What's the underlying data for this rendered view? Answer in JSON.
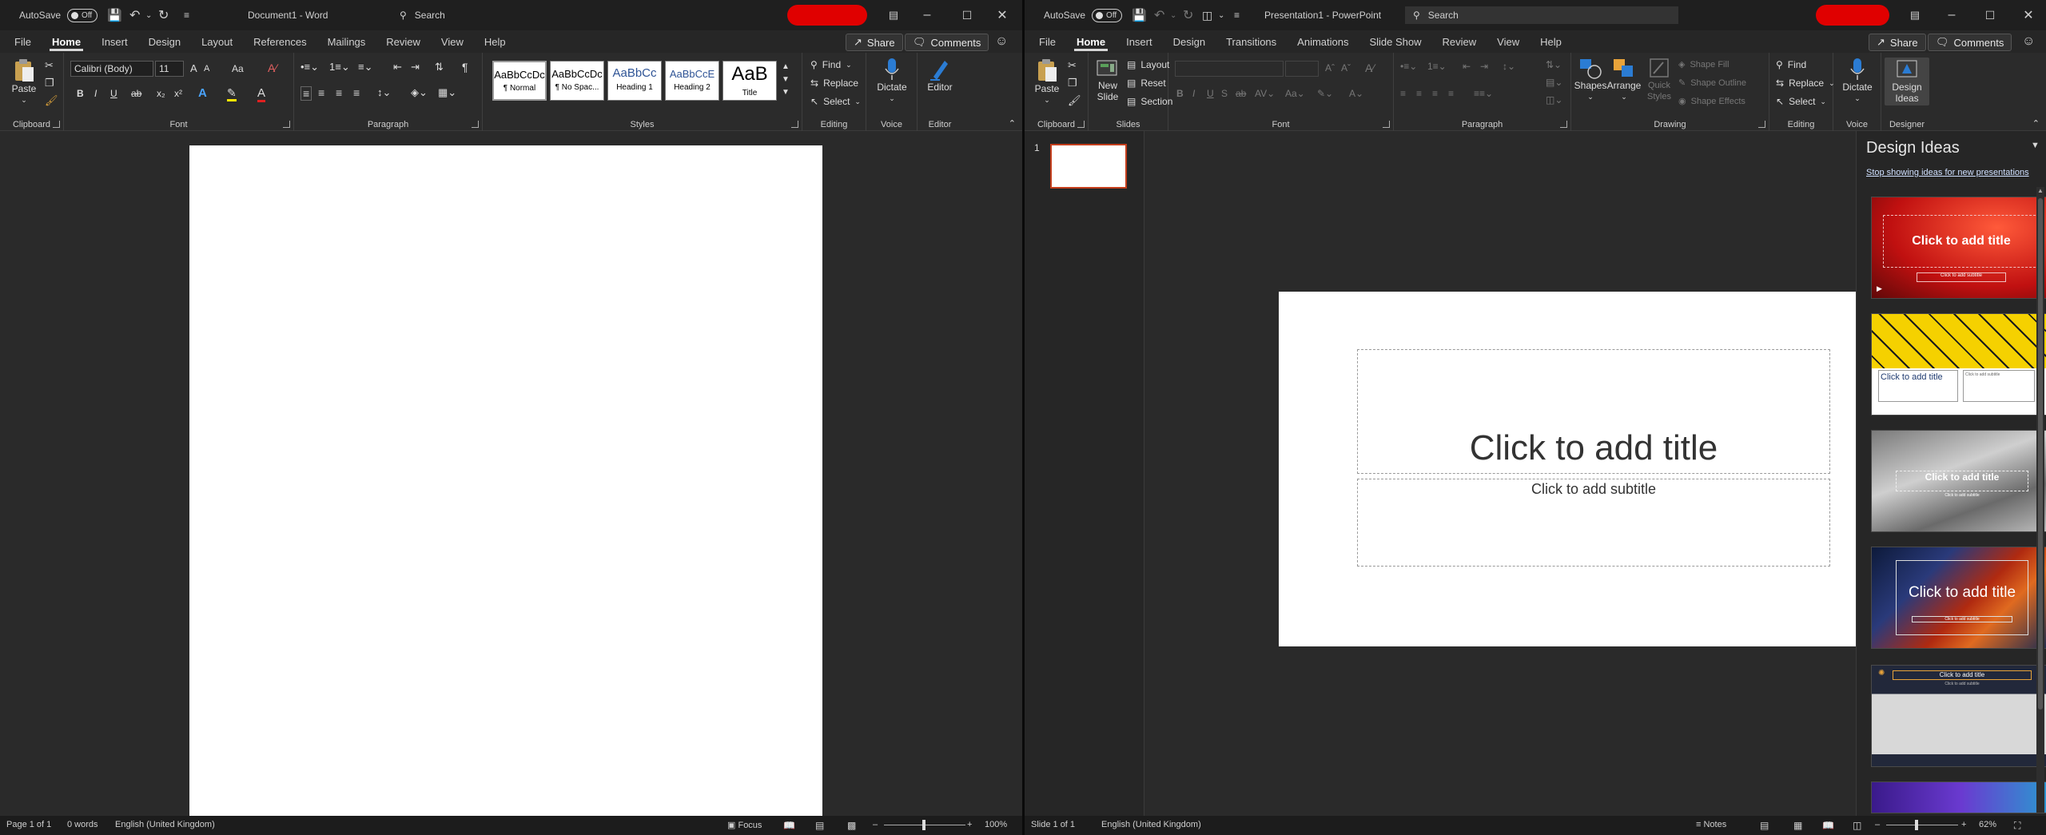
{
  "word": {
    "titlebar": {
      "autosave_label": "AutoSave",
      "autosave_state": "Off",
      "doc_title": "Document1  -  Word",
      "search_placeholder": "Search"
    },
    "tabs": [
      "File",
      "Home",
      "Insert",
      "Design",
      "Layout",
      "References",
      "Mailings",
      "Review",
      "View",
      "Help"
    ],
    "active_tab": "Home",
    "share_label": "Share",
    "comments_label": "Comments",
    "ribbon": {
      "clipboard": {
        "paste": "Paste",
        "label": "Clipboard"
      },
      "font": {
        "name": "Calibri (Body)",
        "size": "11",
        "label": "Font",
        "bold": "B",
        "italic": "I",
        "underline": "U",
        "strike": "ab",
        "sub": "x₂",
        "sup": "x²",
        "grow": "A",
        "shrink": "A",
        "case": "Aa",
        "color_a": "A"
      },
      "paragraph": {
        "label": "Paragraph"
      },
      "styles": {
        "label": "Styles",
        "items": [
          {
            "preview": "AaBbCcDc",
            "name": "¶ Normal"
          },
          {
            "preview": "AaBbCcDc",
            "name": "¶ No Spac..."
          },
          {
            "preview": "AaBbCc",
            "name": "Heading 1"
          },
          {
            "preview": "AaBbCcE",
            "name": "Heading 2"
          },
          {
            "preview": "AaB",
            "name": "Title"
          }
        ]
      },
      "editing": {
        "find": "Find",
        "replace": "Replace",
        "select": "Select",
        "label": "Editing"
      },
      "voice": {
        "dictate": "Dictate",
        "label": "Voice"
      },
      "editor": {
        "editor": "Editor",
        "label": "Editor"
      }
    },
    "status": {
      "page": "Page 1 of 1",
      "words": "0 words",
      "language": "English (United Kingdom)",
      "focus": "Focus",
      "zoom": "100%"
    }
  },
  "ppt": {
    "titlebar": {
      "autosave_label": "AutoSave",
      "autosave_state": "Off",
      "doc_title": "Presentation1  -  PowerPoint",
      "search_placeholder": "Search"
    },
    "tabs": [
      "File",
      "Home",
      "Insert",
      "Design",
      "Transitions",
      "Animations",
      "Slide Show",
      "Review",
      "View",
      "Help"
    ],
    "active_tab": "Home",
    "share_label": "Share",
    "comments_label": "Comments",
    "ribbon": {
      "clipboard": {
        "paste": "Paste",
        "label": "Clipboard"
      },
      "slides": {
        "new_slide": "New Slide",
        "layout": "Layout",
        "reset": "Reset",
        "section": "Section",
        "label": "Slides"
      },
      "font": {
        "label": "Font"
      },
      "paragraph": {
        "label": "Paragraph"
      },
      "drawing": {
        "shapes": "Shapes",
        "arrange": "Arrange",
        "quick_styles": "Quick Styles",
        "shape_fill": "Shape Fill",
        "shape_outline": "Shape Outline",
        "shape_effects": "Shape Effects",
        "label": "Drawing"
      },
      "editing": {
        "find": "Find",
        "replace": "Replace",
        "select": "Select",
        "label": "Editing"
      },
      "voice": {
        "dictate": "Dictate",
        "label": "Voice"
      },
      "designer": {
        "design_ideas": "Design Ideas",
        "label": "Designer"
      }
    },
    "slide_number": "1",
    "slide": {
      "title_placeholder": "Click to add title",
      "subtitle_placeholder": "Click to add subtitle"
    },
    "design_pane": {
      "title": "Design Ideas",
      "stop_link": "Stop showing ideas for new presentations",
      "ideas": [
        {
          "title": "Click to add title",
          "subtitle": "Click to add subtitle"
        },
        {
          "title": "Click to add title",
          "subtitle": "Click to add subtitle"
        },
        {
          "title": "Click to add title",
          "subtitle": "Click to add subtitle"
        },
        {
          "title": "Click to add title",
          "subtitle": "Click to add subtitle"
        },
        {
          "title": "Click to add title",
          "subtitle": "Click to add subtitle"
        }
      ]
    },
    "status": {
      "slide": "Slide 1 of 1",
      "language": "English (United Kingdom)",
      "notes": "Notes",
      "zoom": "62%"
    }
  },
  "colors": {
    "accent_red": "#c43e1c",
    "titlebar_bg": "#1f1f1f",
    "ribbon_bg": "#2b2b2b"
  }
}
